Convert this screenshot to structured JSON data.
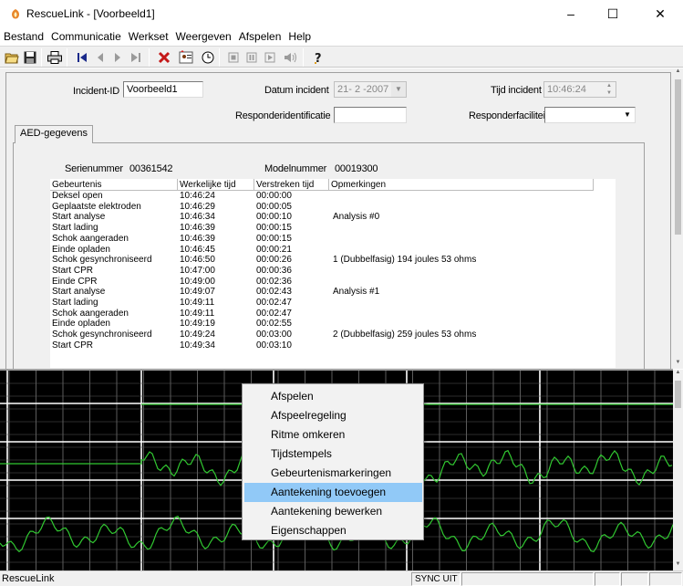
{
  "window": {
    "title": "RescueLink - [Voorbeeld1]",
    "minimize": "–",
    "maximize": "☐",
    "close": "✕"
  },
  "menu": [
    "Bestand",
    "Communicatie",
    "Werkset",
    "Weergeven",
    "Afspelen",
    "Help"
  ],
  "toolbar": {
    "icons": [
      "open-folder-icon",
      "save-icon",
      "print-icon",
      "skip-first-icon",
      "step-back-icon",
      "step-forward-icon",
      "skip-last-icon",
      "delete-icon",
      "patient-data-icon",
      "clock-icon",
      "stop-icon",
      "pause-icon",
      "play-icon",
      "sound-icon",
      "help-icon"
    ]
  },
  "form": {
    "incident_id_label": "Incident-ID",
    "incident_id_value": "Voorbeeld1",
    "datum_label": "Datum incident",
    "datum_value": "21- 2 -2007",
    "tijd_label": "Tijd incident",
    "tijd_value": "10:46:24",
    "responder_id_label": "Responderidentificatie",
    "responder_id_value": "",
    "responder_fac_label": "Responderfaciliteit",
    "responder_fac_value": ""
  },
  "tab": {
    "label": "AED-gegevens"
  },
  "device": {
    "serial_label": "Serienummer",
    "serial_value": "00361542",
    "model_label": "Modelnummer",
    "model_value": "00019300"
  },
  "events": {
    "columns": [
      "Gebeurtenis",
      "Werkelijke tijd",
      "Verstreken tijd",
      "Opmerkingen"
    ],
    "rows": [
      [
        "Deksel open",
        "10:46:24",
        "00:00:00",
        ""
      ],
      [
        "Geplaatste elektroden",
        "10:46:29",
        "00:00:05",
        ""
      ],
      [
        "Start analyse",
        "10:46:34",
        "00:00:10",
        "Analysis #0"
      ],
      [
        "Start lading",
        "10:46:39",
        "00:00:15",
        ""
      ],
      [
        "Schok aangeraden",
        "10:46:39",
        "00:00:15",
        ""
      ],
      [
        "Einde opladen",
        "10:46:45",
        "00:00:21",
        ""
      ],
      [
        "Schok gesynchroniseerd",
        "10:46:50",
        "00:00:26",
        "1 (Dubbelfasig)  194 joules 53 ohms"
      ],
      [
        "Start CPR",
        "10:47:00",
        "00:00:36",
        ""
      ],
      [
        "Einde CPR",
        "10:49:00",
        "00:02:36",
        ""
      ],
      [
        "Start analyse",
        "10:49:07",
        "00:02:43",
        "Analysis #1"
      ],
      [
        "Start lading",
        "10:49:11",
        "00:02:47",
        ""
      ],
      [
        "Schok aangeraden",
        "10:49:11",
        "00:02:47",
        ""
      ],
      [
        "Einde opladen",
        "10:49:19",
        "00:02:55",
        ""
      ],
      [
        "Schok gesynchroniseerd",
        "10:49:24",
        "00:03:00",
        "2 (Dubbelfasig)  259 joules 53 ohms"
      ],
      [
        "Start CPR",
        "10:49:34",
        "00:03:10",
        ""
      ]
    ]
  },
  "context_menu": {
    "items": [
      "Afspelen",
      "Afspeelregeling",
      "Ritme omkeren",
      "Tijdstempels",
      "Gebeurtenismarkeringen",
      "Aantekening toevoegen",
      "Aantekening bewerken",
      "Eigenschappen"
    ],
    "selected_index": 5
  },
  "status": {
    "app": "RescueLink",
    "sync": "SYNC UIT"
  },
  "colors": {
    "waveform": "#31c831",
    "grid": "#ffffff",
    "selection": "#91c9f7",
    "orange_icon": "#e8862a"
  }
}
